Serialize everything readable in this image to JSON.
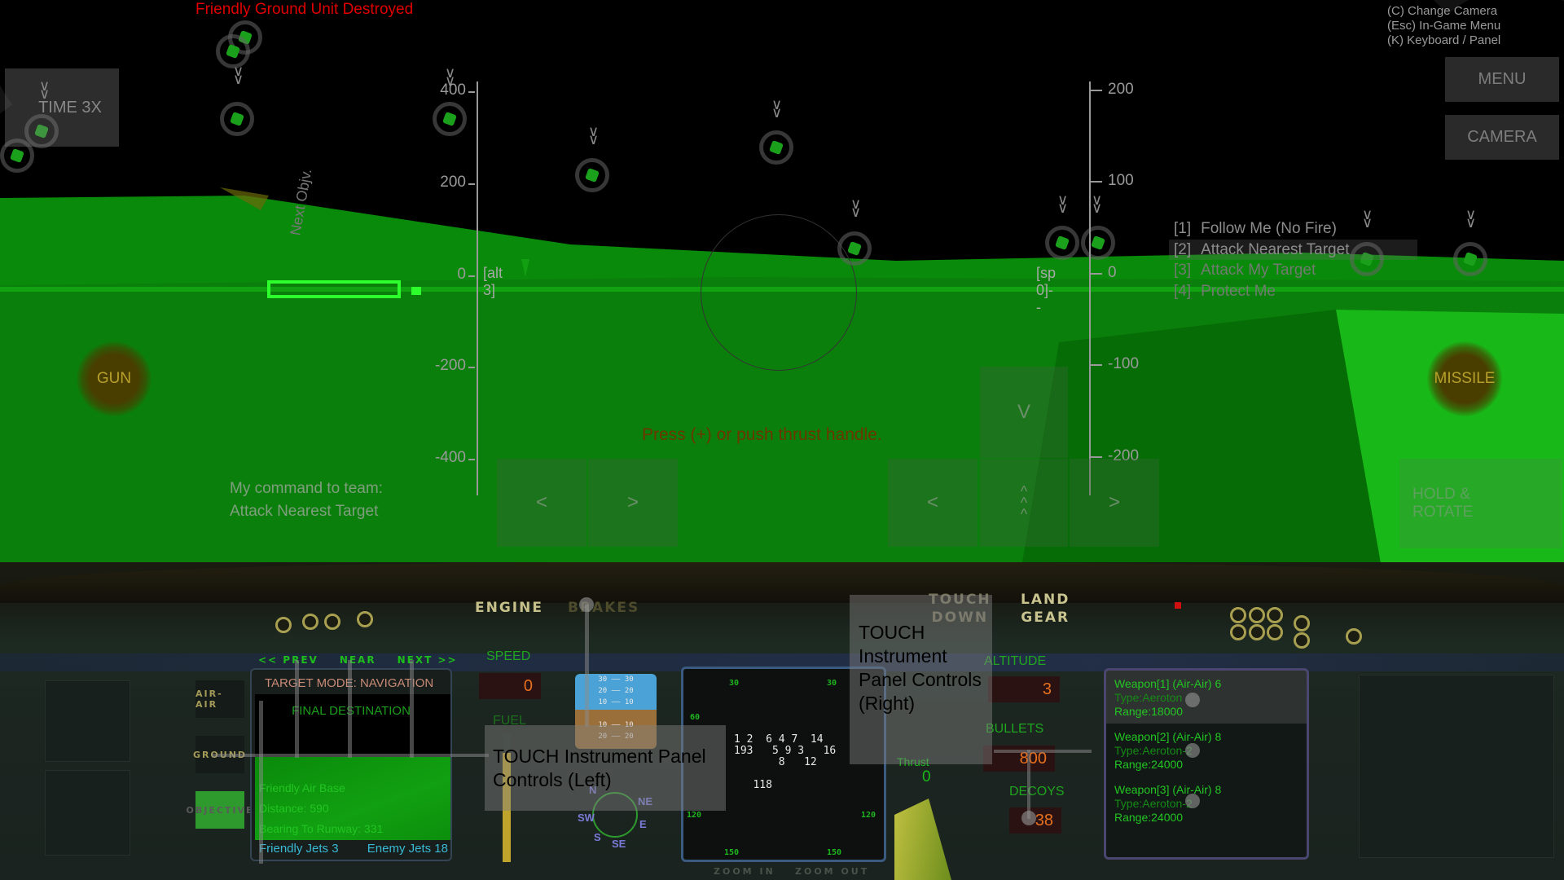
{
  "hud": {
    "alert_message": "Friendly Ground Unit Destroyed",
    "key_hints": [
      "(C) Change Camera",
      "(Esc) In-Game Menu",
      "(K) Keyboard / Panel"
    ],
    "menu_button": "MENU",
    "camera_button": "CAMERA",
    "time_button": "TIME 3X",
    "gun_button": "GUN",
    "missile_button": "MISSILE",
    "next_objective_label": "Next Objv.",
    "team_orders": [
      {
        "key": "[1]",
        "label": "Follow Me (No Fire)",
        "selected": false
      },
      {
        "key": "[2]",
        "label": "Attack Nearest Target",
        "selected": true
      },
      {
        "key": "[3]",
        "label": "Attack My Target",
        "selected": false
      },
      {
        "key": "[4]",
        "label": "Protect Me",
        "selected": false
      }
    ],
    "team_command_label": "My command to team:",
    "team_command_value": "Attack Nearest Target",
    "thrust_hint": "Press (+) or push thrust handle.",
    "hold_rotate": [
      "HOLD &",
      "ROTATE"
    ],
    "left_pad": {
      "left": "<",
      "right": ">"
    },
    "right_pad": {
      "left": "<",
      "up": "^\n^\n^",
      "down": "V",
      "right": ">"
    },
    "altitude_ladder": {
      "ticks": [
        "400",
        "200",
        "0",
        "-200",
        "-400"
      ],
      "tag": "[alt 3]"
    },
    "speed_ladder": {
      "ticks": [
        "200",
        "100",
        "0",
        "-100",
        "-200"
      ],
      "tag": "[sp 0]--"
    }
  },
  "cockpit": {
    "engine_label": "ENGINE",
    "brakes_label": "BRAKES",
    "touchdown_label": [
      "TOUCH",
      "DOWN"
    ],
    "land_gear_label": [
      "LAND",
      "GEAR"
    ],
    "nav_buttons": {
      "prev": "<< PREV",
      "near": "NEAR",
      "next": "NEXT >>"
    },
    "mode_buttons": {
      "air": "AIR-AIR",
      "ground": "GROUND",
      "other": "OBJECTIVE"
    },
    "nav_screen": {
      "mode": "TARGET MODE: NAVIGATION",
      "destination": "FINAL DESTINATION",
      "target_name": "Friendly Air Base",
      "distance": "Distance: 590",
      "bearing": "Bearing To Runway: 331",
      "friendly_jets": "Friendly Jets 3",
      "enemy_jets": "Enemy Jets 18"
    },
    "speed_label": "SPEED",
    "speed_value": "0",
    "fuel_label": "FUEL",
    "fuel_level": 0.85,
    "attitude_lines": [
      "30 —— 30",
      "20 —— 20",
      "10 —— 10",
      "",
      "10 —— 10",
      "20 —— 20"
    ],
    "compass_labels": [
      "N",
      "NE",
      "E",
      "SE",
      "S",
      "SW"
    ],
    "radar": {
      "ranges": [
        "30",
        "30",
        "60",
        "120",
        "120",
        "150",
        "150"
      ],
      "blips": "1 2  6 4 7  14\n193   5 9 3   16\n       8   12\n\n   118",
      "zoom_in": "ZOOM IN",
      "zoom_out": "ZOOM OUT"
    },
    "thrust_label": "Thrust",
    "thrust_value": "0",
    "altitude_label": "ALTITUDE",
    "altitude_value": "3",
    "bullets_label": "BULLETS",
    "bullets_value": "800",
    "decoys_label": "DECOYS",
    "decoys_value": "38",
    "weapons": [
      {
        "title": "Weapon[1] (Air-Air) 6",
        "type": "Type:Aeroton",
        "range": "Range:18000",
        "selected": true
      },
      {
        "title": "Weapon[2] (Air-Air) 8",
        "type": "Type:Aeroton-2",
        "range": "Range:24000",
        "selected": false
      },
      {
        "title": "Weapon[3] (Air-Air) 8",
        "type": "Type:Aeroton-2",
        "range": "Range:24000",
        "selected": false
      }
    ],
    "touch_left": "TOUCH Instrument Panel Controls (Left)",
    "touch_right": "TOUCH Instrument Panel Controls (Right)"
  },
  "colors": {
    "ground": "#0a8a0a",
    "alert": "#e00000",
    "value_orange": "#e6701e",
    "label_green": "#1fa51f",
    "jets_cyan": "#39b9d4"
  }
}
